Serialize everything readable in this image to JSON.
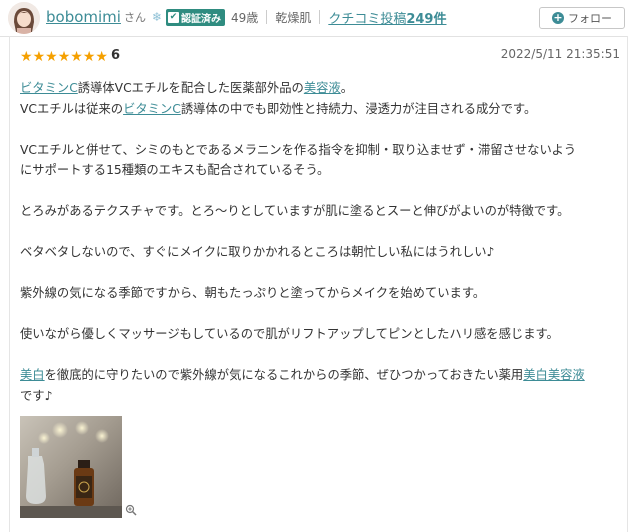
{
  "user": {
    "name": "bobomimi",
    "honorific": "さん",
    "verified_label": "認証済み",
    "age": "49歳",
    "skin_type": "乾燥肌",
    "posts_label": "クチコミ投稿",
    "posts_count": "249件"
  },
  "follow": {
    "label": "フォロー",
    "icon": "plus-circle-icon"
  },
  "review": {
    "stars": 7,
    "max_stars": 7,
    "score": "6",
    "datetime": "2022/5/11 21:35:51",
    "lines": {
      "l1_kw1": "ビタミンC",
      "l1_t1": "誘導体VCエチルを配合した医薬部外品の",
      "l1_kw2": "美容液",
      "l1_t2": "。",
      "l2_t1": "VCエチルは従来の",
      "l2_kw": "ビタミンC",
      "l2_t2": "誘導体の中でも即効性と持続力、浸透力が注目される成分です。",
      "l3": "VCエチルと併せて、シミのもとであるメラニンを作る指令を抑制・取り込ませず・滞留させないよう",
      "l4": "にサポートする15種類のエキスも配合されているそう。",
      "l5": "とろみがあるテクスチャです。とろ～りとしていますが肌に塗るとスーと伸びがよいのが特徴です。",
      "l6": "ベタベタしないので、すぐにメイクに取りかかれるところは朝忙しい私にはうれしい♪",
      "l7": "紫外線の気になる季節ですから、朝もたっぷりと塗ってからメイクを始めています。",
      "l8": "使いながら優しくマッサージもしているので肌がリフトアップしてピンとしたハリ感を感じます。",
      "l9_kw1": "美白",
      "l9_t1": "を徹底的に守りたいので紫外線が気になるこれからの季節、ぜひつかっておきたい薬用",
      "l9_kw2": "美白美容液",
      "l10": "です♪"
    }
  },
  "colors": {
    "accent": "#3d8c96",
    "star": "#f5a000",
    "verified": "#2f8c80"
  },
  "icons": {
    "snow": "snowflake-icon",
    "zoom": "zoom-in-icon"
  }
}
